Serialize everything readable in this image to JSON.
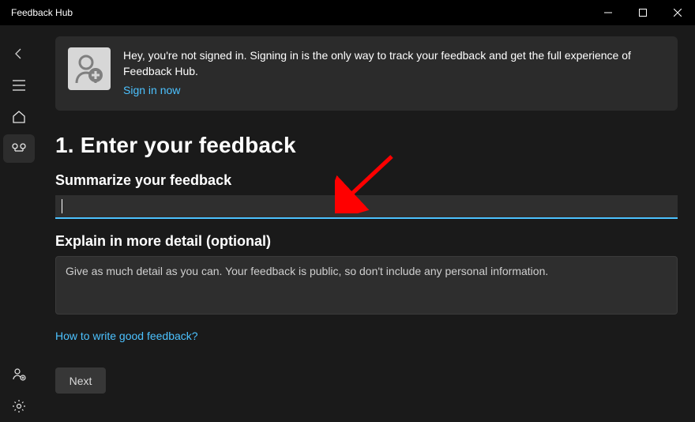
{
  "titlebar": {
    "title": "Feedback Hub"
  },
  "banner": {
    "message": "Hey, you're not signed in. Signing in is the only way to track your feedback and get the full experience of Feedback Hub.",
    "signin": "Sign in now"
  },
  "section": {
    "title": "1. Enter your feedback",
    "summary_label": "Summarize your feedback",
    "summary_value": "",
    "detail_label": "Explain in more detail (optional)",
    "detail_placeholder": "Give as much detail as you can. Your feedback is public, so don't include any personal information.",
    "help_link": "How to write good feedback?",
    "next": "Next"
  }
}
